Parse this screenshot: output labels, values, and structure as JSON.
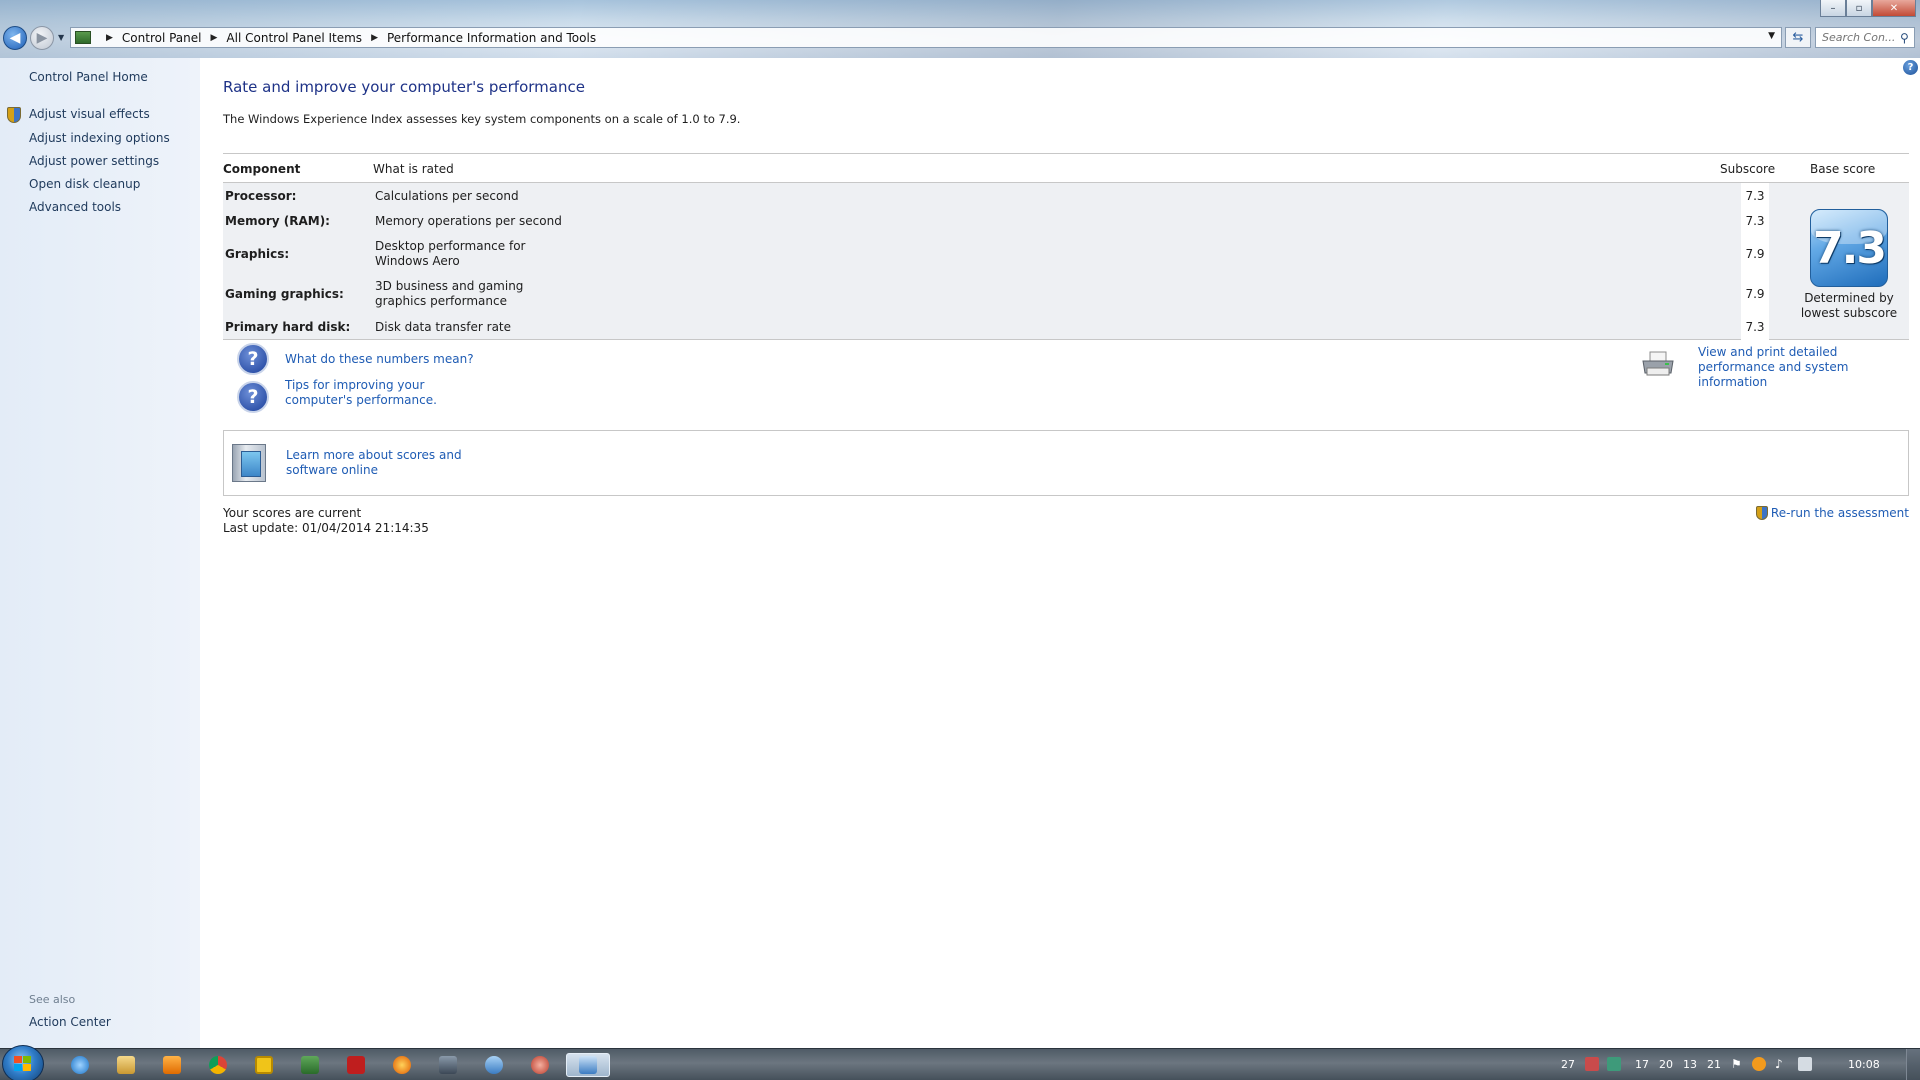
{
  "window": {
    "minimize": "–",
    "maximize": "▫",
    "close": "✕"
  },
  "address": {
    "crumbs": [
      "Control Panel",
      "All Control Panel Items",
      "Performance Information and Tools"
    ],
    "search_placeholder": "Search Con..."
  },
  "left_pane": {
    "home": "Control Panel Home",
    "tasks": [
      "Adjust visual effects",
      "Adjust indexing options",
      "Adjust power settings",
      "Open disk cleanup",
      "Advanced tools"
    ],
    "see_also_title": "See also",
    "see_also": [
      "Action Center"
    ]
  },
  "main": {
    "title": "Rate and improve your computer's performance",
    "intro": "The Windows Experience Index assesses key system components on a scale of 1.0 to 7.9.",
    "columns": {
      "component": "Component",
      "what": "What is rated",
      "subscore": "Subscore",
      "base": "Base score"
    },
    "rows": [
      {
        "component": "Processor:",
        "what": "Calculations per second",
        "subscore": "7.3"
      },
      {
        "component": "Memory (RAM):",
        "what": "Memory operations per second",
        "subscore": "7.3"
      },
      {
        "component": "Graphics:",
        "what": "Desktop performance for Windows Aero",
        "subscore": "7.9"
      },
      {
        "component": "Gaming graphics:",
        "what": "3D business and gaming graphics performance",
        "subscore": "7.9"
      },
      {
        "component": "Primary hard disk:",
        "what": "Disk data transfer rate",
        "subscore": "7.3"
      }
    ],
    "base_score": "7.3",
    "base_note": "Determined by lowest subscore",
    "links": {
      "numbers": "What do these numbers mean?",
      "tips": "Tips for improving your computer's performance.",
      "print": "View and print detailed performance and system information",
      "learn": "Learn more about scores and software online"
    },
    "status": {
      "current": "Your scores are current",
      "last_update": "Last update: 01/04/2014 21:14:35"
    },
    "rerun": "Re-run the assessment"
  },
  "taskbar": {
    "tray_numbers": [
      "27",
      "17",
      "20",
      "13",
      "21"
    ],
    "clock": "10:08",
    "app_icons": [
      "internet-explorer-icon",
      "explorer-icon",
      "media-player-icon",
      "chrome-icon",
      "outlook-icon",
      "app-icon",
      "filezilla-icon",
      "app-icon",
      "app-icon",
      "app-icon",
      "app-icon",
      "control-panel-icon"
    ]
  },
  "colors": {
    "link": "#1f5cb4",
    "title": "#1e3287",
    "left_pane_bg": "#e3ecf7",
    "table_band": "#eef0f3"
  }
}
